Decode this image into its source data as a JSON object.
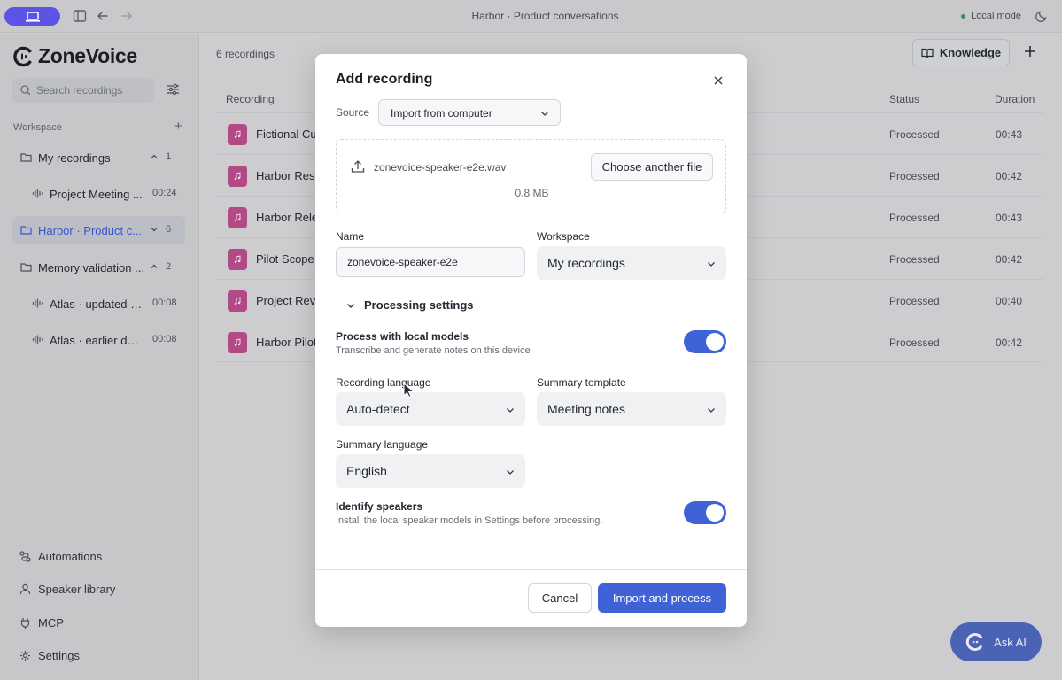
{
  "window": {
    "title": "Harbor · Product conversations",
    "mode": "Local mode"
  },
  "sidebar": {
    "app_name": "ZoneVoice",
    "search_placeholder": "Search recordings",
    "workspace_label": "Workspace",
    "folders": [
      {
        "label": "My recordings",
        "count": "1"
      },
      {
        "label": "Harbor · Product c...",
        "count": "6"
      },
      {
        "label": "Memory validation ...",
        "count": "2"
      }
    ],
    "sub_items": [
      {
        "label": "Project Meeting ...",
        "duration": "00:24"
      },
      {
        "label": "Atlas · updated d...",
        "duration": "00:08"
      },
      {
        "label": "Atlas · earlier dec...",
        "duration": "00:08"
      }
    ],
    "bottom": [
      "Automations",
      "Speaker library",
      "MCP",
      "Settings"
    ]
  },
  "main": {
    "count_label": "6 recordings",
    "knowledge_label": "Knowledge",
    "columns": {
      "recording": "Recording",
      "status": "Status",
      "duration": "Duration"
    },
    "rows": [
      {
        "name": "Fictional Cu",
        "status": "Processed",
        "duration": "00:43"
      },
      {
        "name": "Harbor Rese",
        "status": "Processed",
        "duration": "00:42"
      },
      {
        "name": "Harbor Rele",
        "status": "Processed",
        "duration": "00:43"
      },
      {
        "name": "Pilot Scope",
        "status": "Processed",
        "duration": "00:42"
      },
      {
        "name": "Project Revi",
        "status": "Processed",
        "duration": "00:40"
      },
      {
        "name": "Harbor Pilot",
        "status": "Processed",
        "duration": "00:42"
      }
    ],
    "ask_ai": "Ask AI"
  },
  "modal": {
    "title": "Add recording",
    "source_label": "Source",
    "source_value": "Import from computer",
    "file_name": "zonevoice-speaker-e2e.wav",
    "file_size": "0.8 MB",
    "choose_label": "Choose another file",
    "name_label": "Name",
    "name_value": "zonevoice-speaker-e2e",
    "workspace_label": "Workspace",
    "workspace_value": "My recordings",
    "processing_label": "Processing settings",
    "local_title": "Process with local models",
    "local_desc": "Transcribe and generate notes on this device",
    "rec_lang_label": "Recording language",
    "rec_lang_value": "Auto-detect",
    "template_label": "Summary template",
    "template_value": "Meeting notes",
    "sum_lang_label": "Summary language",
    "sum_lang_value": "English",
    "speakers_title": "Identify speakers",
    "speakers_desc": "Install the local speaker models in Settings before processing.",
    "cancel_label": "Cancel",
    "import_label": "Import and process"
  }
}
